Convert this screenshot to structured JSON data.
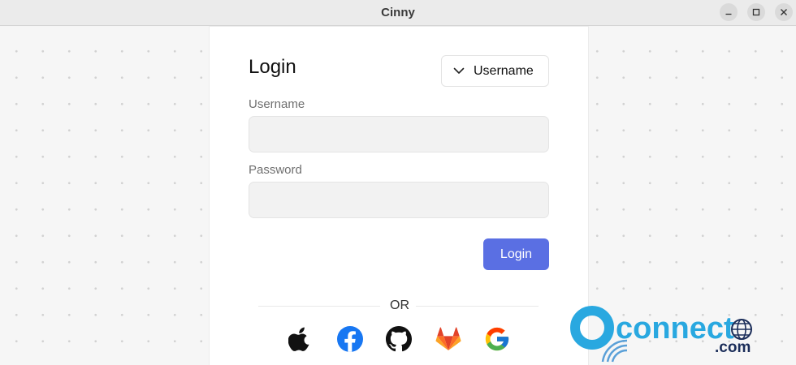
{
  "window": {
    "title": "Cinny",
    "buttons": [
      "minimize-icon",
      "maximize-icon",
      "close-icon"
    ]
  },
  "login": {
    "heading": "Login",
    "type_selector": "Username",
    "username_label": "Username",
    "username_value": "",
    "password_label": "Password",
    "password_value": "",
    "submit_label": "Login",
    "or_text": "OR",
    "providers": [
      "apple-icon",
      "facebook-icon",
      "github-icon",
      "gitlab-icon",
      "google-icon"
    ]
  },
  "watermark": {
    "brand": "connect",
    "suffix": ".com"
  },
  "colors": {
    "accent": "#5a6fe3",
    "facebook": "#1877f2",
    "gitlab": "#fc6d26",
    "watermark": "#29a8e0"
  }
}
